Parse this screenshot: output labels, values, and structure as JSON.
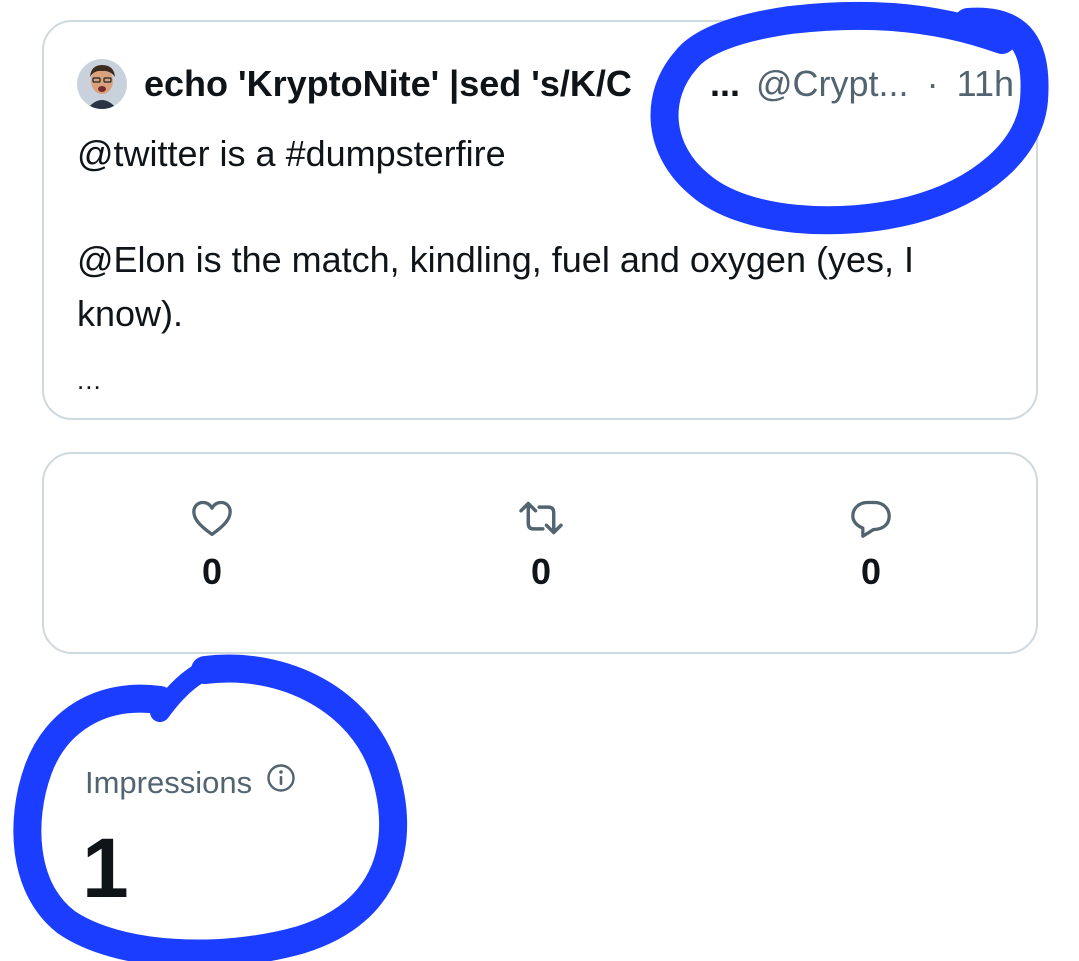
{
  "tweet": {
    "display_name": "echo 'KryptoNite' |sed 's/K/C",
    "name_ellipsis": "...",
    "handle": "@Crypt...",
    "separator": "·",
    "time": "11h",
    "lines": [
      "@twitter is a #dumpsterfire",
      "@Elon is the match, kindling, fuel and oxygen (yes, I know)."
    ],
    "more": "..."
  },
  "actions": {
    "likes": {
      "icon": "heart-icon",
      "count": "0"
    },
    "retweets": {
      "icon": "retweet-icon",
      "count": "0"
    },
    "replies": {
      "icon": "reply-icon",
      "count": "0"
    }
  },
  "impressions": {
    "label": "Impressions",
    "info_icon": "info-icon",
    "value": "1"
  },
  "colors": {
    "text": "#0f1419",
    "secondary": "#536471",
    "border": "#cfd9de",
    "annotation": "#1a3dff"
  }
}
